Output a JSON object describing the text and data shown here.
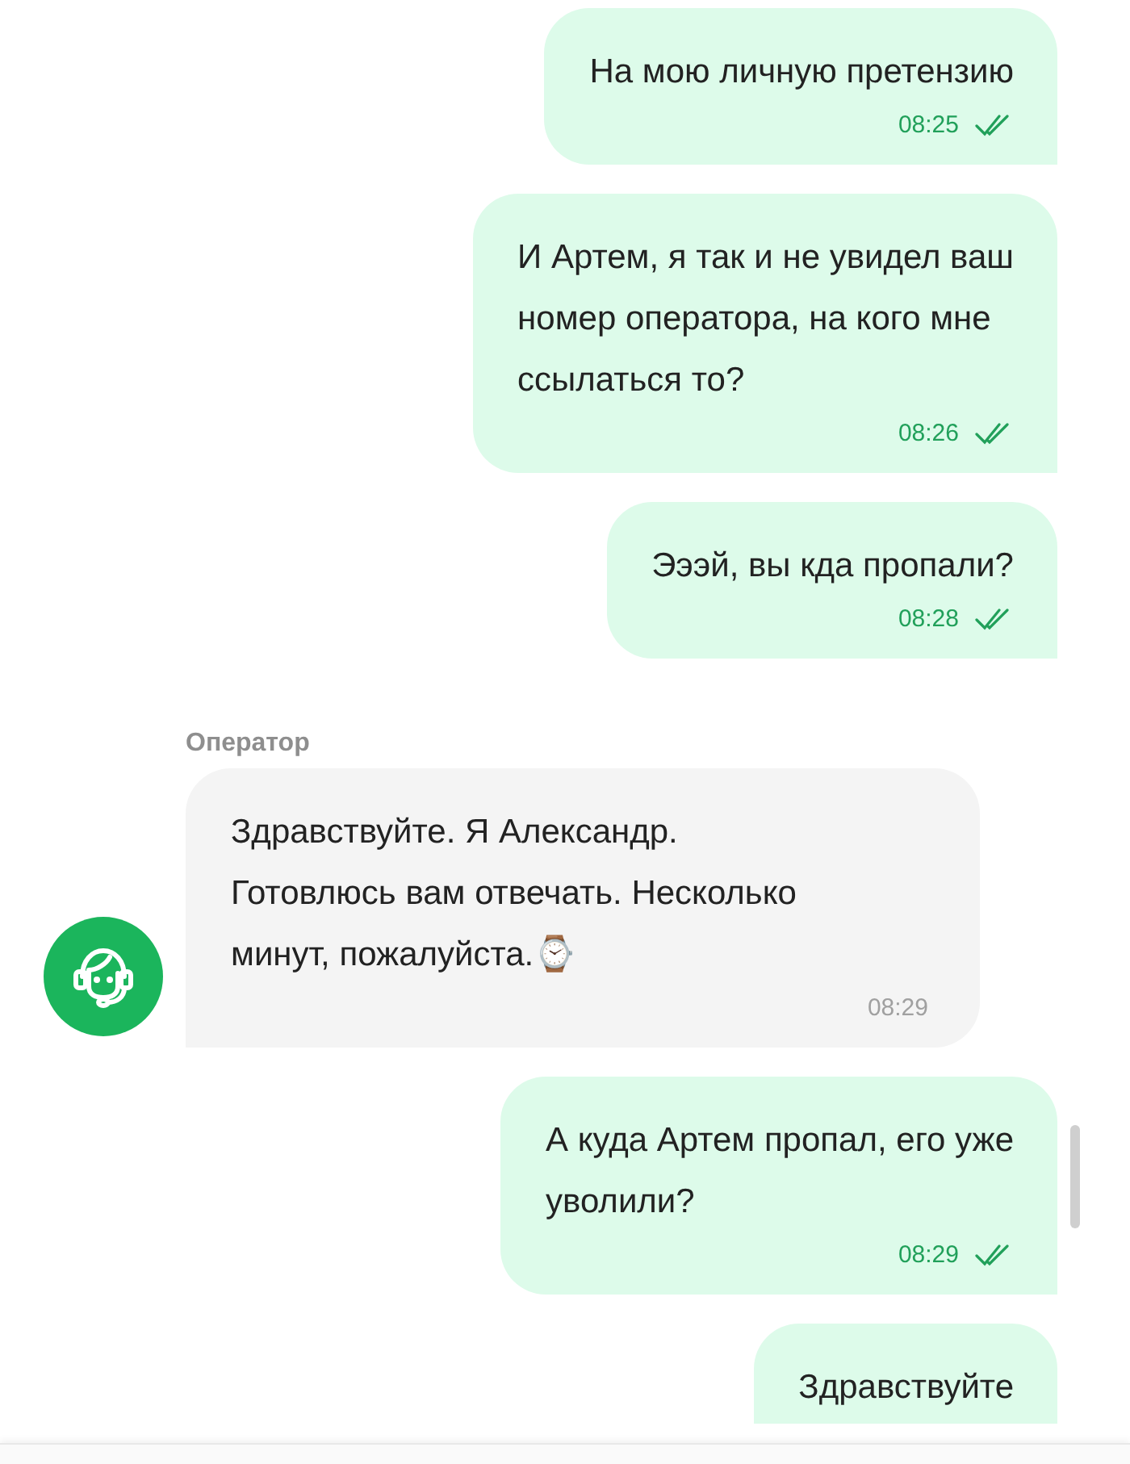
{
  "messages": [
    {
      "kind": "outgoing",
      "text": "На мою личную претензию",
      "time": "08:25",
      "read": true
    },
    {
      "kind": "outgoing",
      "text": "И Артем, я так и не увидел ваш\nномер оператора, на кого мне\nссылаться то?",
      "time": "08:26",
      "read": true
    },
    {
      "kind": "outgoing",
      "text": "Эээй, вы кда пропали?",
      "time": "08:28",
      "read": true
    },
    {
      "kind": "incoming",
      "sender": "Оператор",
      "text": "Здравствуйте. Я Александр.\nГотовлюсь вам отвечать. Несколько\nминут, пожалуйста.⌚",
      "time": "08:29"
    },
    {
      "kind": "outgoing",
      "text": "А куда Артем пропал, его уже\nуволили?",
      "time": "08:29",
      "read": true
    },
    {
      "kind": "outgoing",
      "text": "Здравствуйте",
      "partial": true
    }
  ]
}
